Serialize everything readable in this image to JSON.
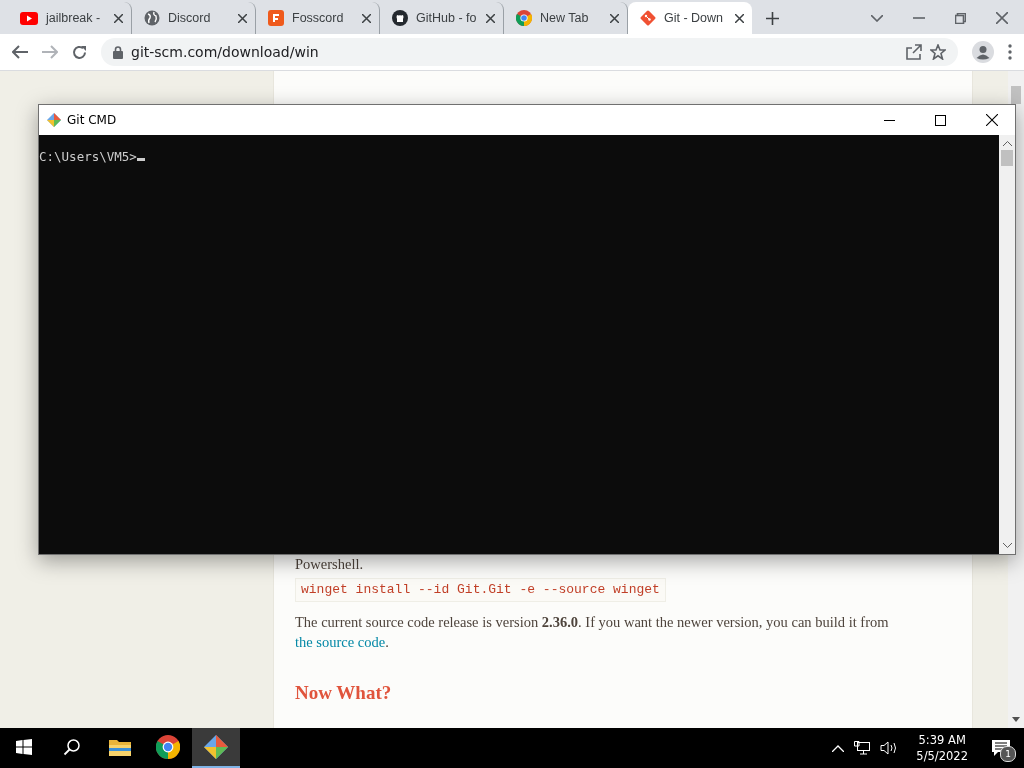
{
  "browser": {
    "tabs": [
      {
        "title": "jailbreak -",
        "kind": "youtube",
        "selected": false
      },
      {
        "title": "Discord",
        "kind": "globe",
        "selected": false
      },
      {
        "title": "Fosscord",
        "kind": "fosscord",
        "selected": false
      },
      {
        "title": "GitHub - fo",
        "kind": "github",
        "selected": false
      },
      {
        "title": "New Tab",
        "kind": "chrome",
        "selected": false
      },
      {
        "title": "Git - Down",
        "kind": "git",
        "selected": true
      }
    ],
    "address": "git-scm.com/download/win",
    "page": {
      "powershell": "Powershell.",
      "code": "winget install --id Git.Git -e --source winget",
      "release_text": "The current source code release is version **2.36.0**. If you want the newer version, you can build it from",
      "release_link": "the source code",
      "release_end": ".",
      "heading": "Now What?"
    }
  },
  "cmd_window": {
    "title": "Git CMD",
    "lines": [
      "C:\\Users\\VM5>"
    ]
  },
  "taskbar": {
    "apps": [
      {
        "kind": "start",
        "selected": false
      },
      {
        "kind": "search",
        "selected": false
      },
      {
        "kind": "explorer",
        "selected": false
      },
      {
        "kind": "chrome",
        "selected": false
      },
      {
        "kind": "git",
        "selected": true
      }
    ],
    "time": "5:39 AM",
    "date": "5/5/2022",
    "notification_count": "1"
  }
}
